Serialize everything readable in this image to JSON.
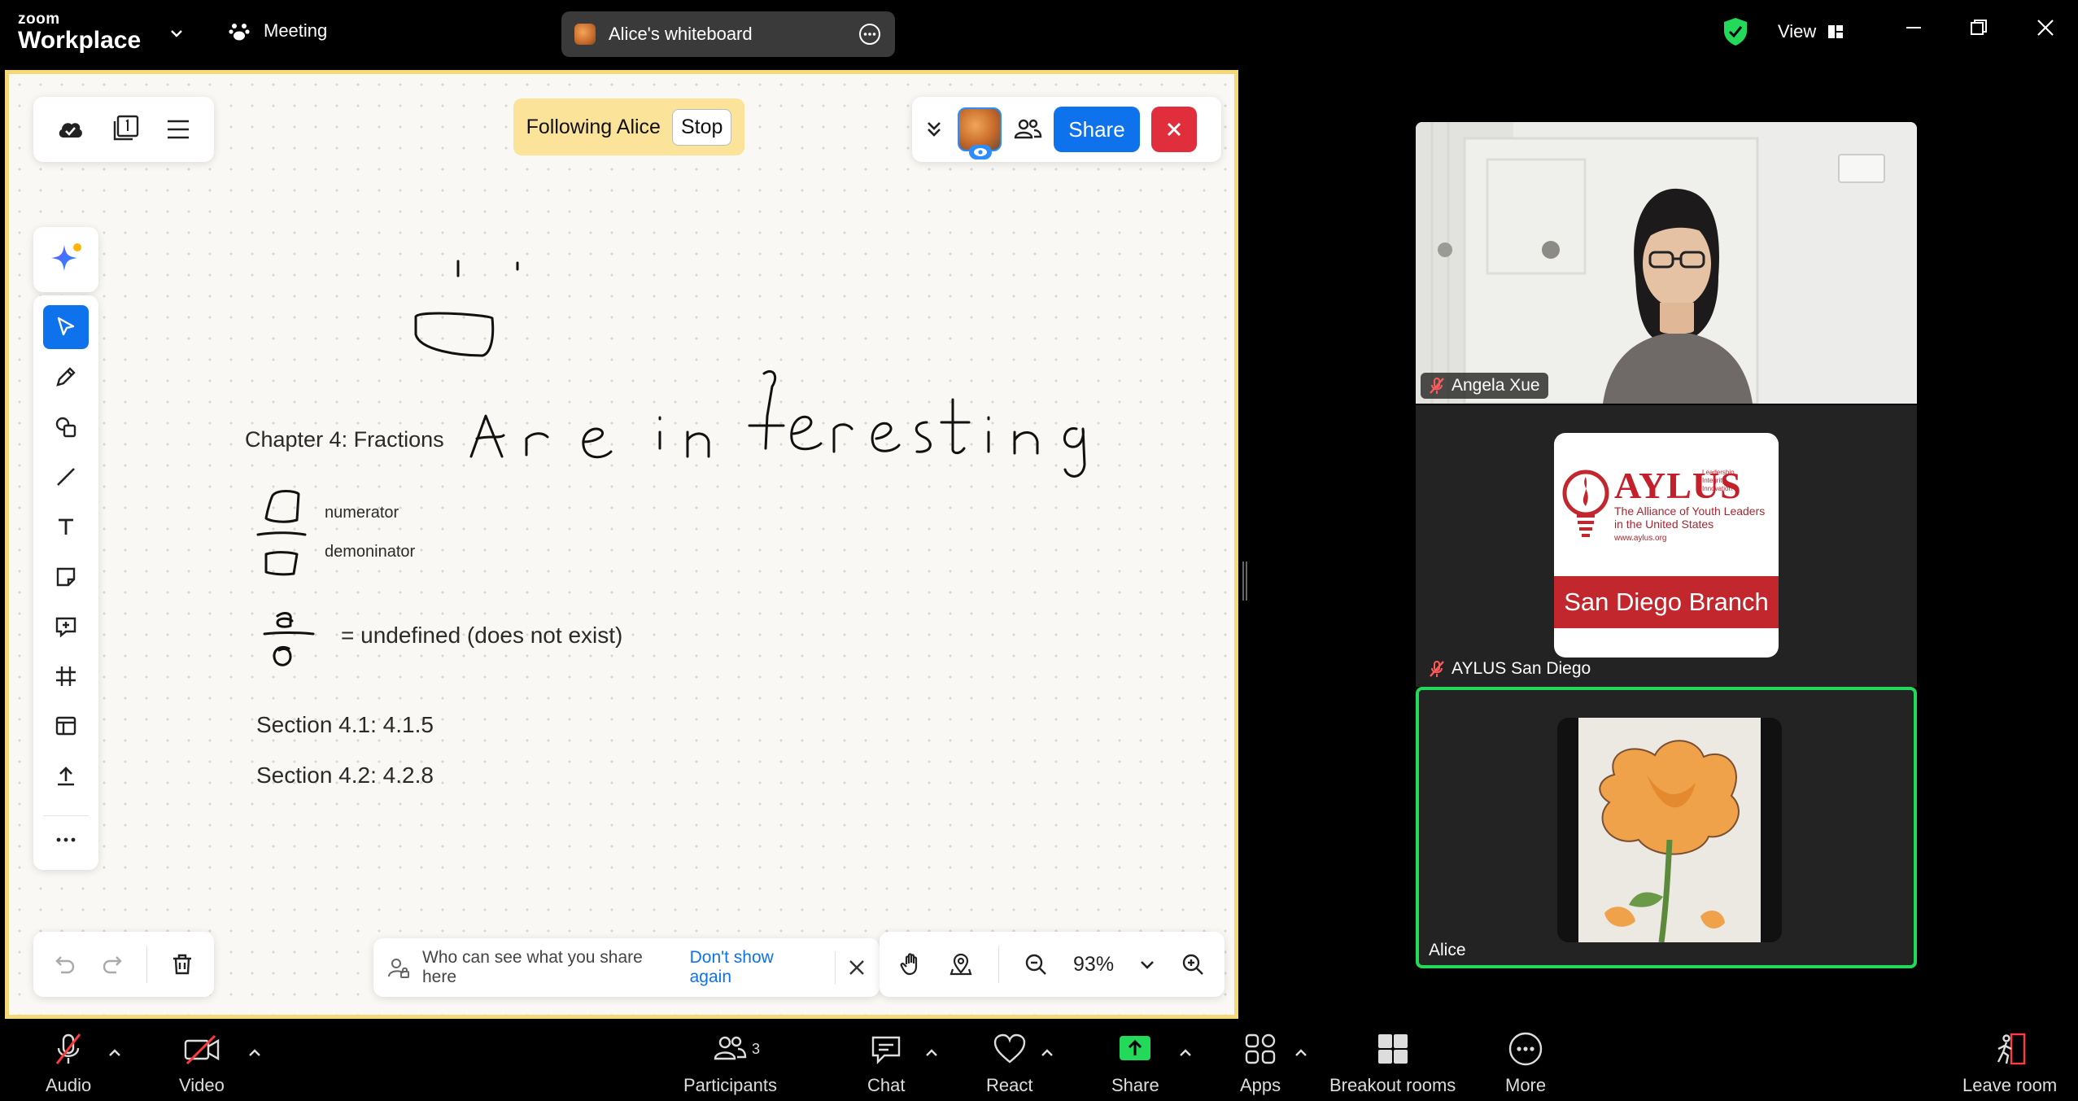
{
  "title_bar": {
    "brand_top": "zoom",
    "brand_bottom": "Workplace",
    "meeting_label": "Meeting",
    "whiteboard_tab": "Alice's whiteboard",
    "view_label": "View"
  },
  "whiteboard": {
    "following_text": "Following Alice",
    "stop_label": "Stop",
    "share_label": "Share",
    "notice_text": "Who can see what you share here",
    "notice_link": "Don't show again",
    "zoom_level": "93%",
    "content": {
      "chapter_title": "Chapter 4: Fractions",
      "handwriting": "Are interesting",
      "numerator": "numerator",
      "denominator": "demoninator",
      "undefined": "= undefined (does not exist)",
      "section1": "Section 4.1: 4.1.5",
      "section2": "Section 4.2: 4.2.8"
    },
    "tools": [
      "select-tool",
      "pen-tool",
      "shapes-tool",
      "line-tool",
      "text-tool",
      "sticky-note-tool",
      "comment-tool",
      "frame-tool",
      "template-tool",
      "upload-tool",
      "more-tools"
    ],
    "accent_color": "#0e72ed",
    "frame_color": "#f5d978"
  },
  "participants_panel": {
    "tiles": [
      {
        "name": "Angela Xue",
        "muted": true
      },
      {
        "name": "AYLUS San Diego",
        "muted": true
      },
      {
        "name": "Alice",
        "muted": false,
        "active_speaker": true
      }
    ],
    "aylus_logo": {
      "title": "AYLUS",
      "tagline": [
        "Leadership",
        "Integrity",
        "Innovation"
      ],
      "subtitle_1": "The Alliance of Youth Leaders",
      "subtitle_2": "in the United States",
      "url": "www.aylus.org",
      "branch": "San Diego Branch"
    },
    "active_border_color": "#23d959"
  },
  "toolbar": {
    "audio": "Audio",
    "video": "Video",
    "participants": "Participants",
    "participants_count": "3",
    "chat": "Chat",
    "react": "React",
    "share": "Share",
    "apps": "Apps",
    "breakout": "Breakout rooms",
    "more": "More",
    "leave": "Leave room"
  }
}
